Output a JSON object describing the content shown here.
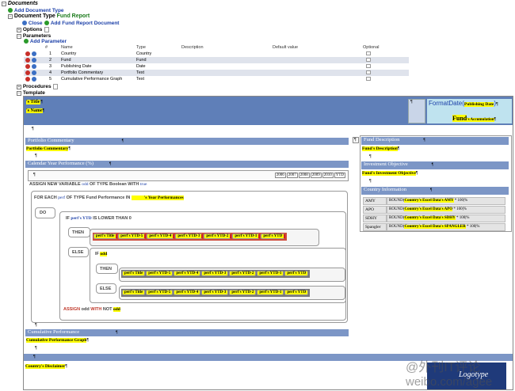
{
  "tree": {
    "root": "Documents",
    "add_doc_type": "Add Document Type",
    "doc_type_label": "Document Type",
    "doc_type_name": "Fund Report",
    "close": "Close",
    "add_fund_report_doc": "Add Fund Report Document",
    "options": "Options",
    "parameters": "Parameters",
    "add_parameter": "Add Parameter",
    "procedures": "Procedures",
    "template": "Template"
  },
  "params": {
    "headers": [
      "#",
      "Name",
      "Type",
      "Description",
      "Default value",
      "Optional"
    ],
    "rows": [
      {
        "n": "1",
        "name": "Country",
        "type": "Country"
      },
      {
        "n": "2",
        "name": "Fund",
        "type": "Fund"
      },
      {
        "n": "3",
        "name": "Publishing Date",
        "type": "Date"
      },
      {
        "n": "4",
        "name": "Portfolio Commentary",
        "type": "Text"
      },
      {
        "n": "5",
        "name": "Cumulative Performance Graph",
        "type": "Text"
      }
    ]
  },
  "template": {
    "title_chip": "'s Title",
    "name_chip": "'s Name",
    "format_date": "FormatDate(",
    "publishing_date": "Publishing Date",
    "format_date_close": ")",
    "fund_label": "Fund",
    "accumulation": "'s Accumulation",
    "portfolio_commentary_header": "Portfolio Commentary",
    "portfolio_commentary_value": "Portfolio Commentary",
    "calendar_year_header": "Calendar Year Performance (%)",
    "years": [
      "2006",
      "2007",
      "2008",
      "2009",
      "2010",
      "YTD"
    ],
    "assign_stmt_a": "ASSIGN NEW VARIABLE",
    "assign_var": "odd",
    "assign_stmt_b": "OF TYPE Boolean WITH",
    "assign_val": "true",
    "for_each_a": "FOR EACH",
    "for_each_var": "perf",
    "for_each_b": "OF TYPE Fund Performance IN",
    "for_each_src": "'s Year Performances",
    "do_label": "DO",
    "if_label": "IF",
    "if_cond": "perf's YTD",
    "if_rest": "IS LOWER THAN 0",
    "then_label": "THEN",
    "else_label": "ELSE",
    "if_odd": "IF",
    "odd": "odd",
    "perf_row": [
      "perf's Title",
      "perf's YTD-5",
      "perf's YTD-4",
      "perf's YTD-3",
      "perf's YTD-2",
      "perf's YTD-1",
      "perf's YTD"
    ],
    "assign_odd_a": "ASSIGN",
    "assign_odd_b": "odd",
    "assign_odd_c": "WITH",
    "assign_odd_d": "NOT",
    "assign_odd_e": "odd",
    "cumulative_header": "Cumulative Performance",
    "cumulative_value": "Cumulative Performance Graph",
    "disclaimer": "Country's Disclaimer",
    "fund_description_header": "Fund Description",
    "fund_description_value": "Fund's Description",
    "investment_objective_header": "Investment Objective",
    "investment_objective_value": "Fund's Investment Objective",
    "country_info_header": "Country Information",
    "country_rows": [
      {
        "code": "AMY",
        "expr": "Country's Excel Data's AMY",
        "suffix": "* 100|%"
      },
      {
        "code": "APO",
        "expr": "Country's Excel Data's APO",
        "suffix": "* 100|%"
      },
      {
        "code": "SDHY",
        "expr": "Country's Excel Data's SDHY",
        "suffix": "* 100|%"
      },
      {
        "code": "Spangler",
        "expr": "Country's Excel Data's SPANGLER",
        "suffix": "* 100|%"
      }
    ],
    "round_label": "ROUND(",
    "logotype": "Logotype"
  },
  "watermark": {
    "line1": "@外刊IT评论",
    "line2": "weibo.com/agee"
  }
}
